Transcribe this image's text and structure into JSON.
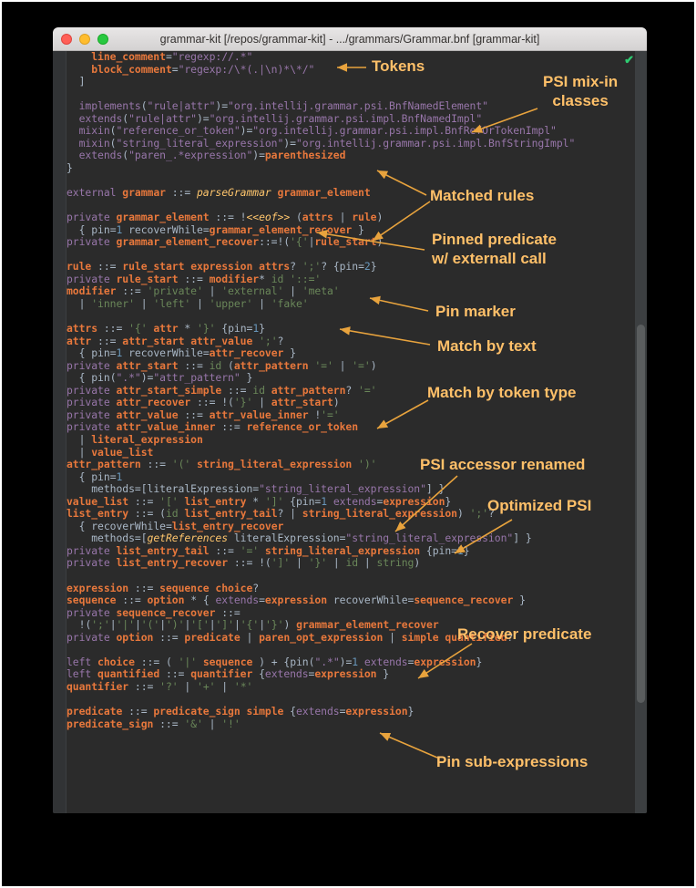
{
  "window": {
    "title": "grammar-kit [/repos/grammar-kit] - .../grammars/Grammar.bnf [grammar-kit]",
    "traffic_lights": [
      "close-button",
      "minimize-button",
      "zoom-button"
    ],
    "status_icon": "✔"
  },
  "colors": {
    "editor_background": "#2b2b2b",
    "gutter": "#313335",
    "annotation": "#ffc069",
    "rule_name": "#e8783c",
    "keyword": "#9876aa",
    "string": "#6a8759",
    "number": "#6897bb",
    "default_text": "#a9b7c6",
    "status_ok": "#2ecc71",
    "titlebar": "#e0dede",
    "page_background": "#000000"
  },
  "annotations": [
    {
      "id": "tokens",
      "label": "Tokens"
    },
    {
      "id": "psi-mixin",
      "label": "PSI mix-in\nclasses"
    },
    {
      "id": "matched-rules",
      "label": "Matched rules"
    },
    {
      "id": "pinned-predicate",
      "label": "Pinned predicate\nw/ externall call"
    },
    {
      "id": "pin-marker",
      "label": "Pin marker"
    },
    {
      "id": "match-by-text",
      "label": "Match by text"
    },
    {
      "id": "match-by-token",
      "label": "Match by token type"
    },
    {
      "id": "psi-accessor",
      "label": "PSI accessor renamed"
    },
    {
      "id": "optimized-psi",
      "label": "Optimized PSI"
    },
    {
      "id": "recover-predicate",
      "label": "Recover predicate"
    },
    {
      "id": "pin-sub",
      "label": "Pin sub-expressions"
    }
  ],
  "code": {
    "language": "BNF",
    "file": "Grammar.bnf",
    "lines": [
      "    line_comment=\"regexp://.*\"",
      "    block_comment=\"regexp:/\\*(.|\\n)*\\*/\"",
      "  ]",
      "",
      "  implements(\"rule|attr\")=\"org.intellij.grammar.psi.BnfNamedElement\"",
      "  extends(\"rule|attr\")=\"org.intellij.grammar.psi.impl.BnfNamedImpl\"",
      "  mixin(\"reference_or_token\")=\"org.intellij.grammar.psi.impl.BnfRefOrTokenImpl\"",
      "  mixin(\"string_literal_expression\")=\"org.intellij.grammar.psi.impl.BnfStringImpl\"",
      "  extends(\"paren_.*expression\")=parenthesized",
      "}",
      "",
      "external grammar ::= parseGrammar grammar_element",
      "",
      "private grammar_element ::= !<<eof>> (attrs | rule)",
      "  { pin=1 recoverWhile=grammar_element_recover }",
      "private grammar_element_recover::=!('{'|rule_start)",
      "",
      "rule ::= rule_start expression attrs? ';'? {pin=2}",
      "private rule_start ::= modifier* id '::='",
      "modifier ::= 'private' | 'external' | 'meta'",
      "  | 'inner' | 'left' | 'upper' | 'fake'",
      "",
      "attrs ::= '{' attr * '}' {pin=1}",
      "attr ::= attr_start attr_value ';'?",
      "  { pin=1 recoverWhile=attr_recover }",
      "private attr_start ::= id (attr_pattern '=' | '=')",
      "  { pin(\".*\")=\"attr_pattern\" }",
      "private attr_start_simple ::= id attr_pattern? '='",
      "private attr_recover ::= !('}' | attr_start)",
      "private attr_value ::= attr_value_inner !'='",
      "private attr_value_inner ::= reference_or_token",
      "  | literal_expression",
      "  | value_list",
      "attr_pattern ::= '(' string_literal_expression ')'",
      "  { pin=1",
      "    methods=[literalExpression=\"string_literal_expression\"] }",
      "value_list ::= '[' list_entry * ']' {pin=1 extends=expression}",
      "list_entry ::= (id list_entry_tail? | string_literal_expression) ';'?",
      "  { recoverWhile=list_entry_recover",
      "    methods=[getReferences literalExpression=\"string_literal_expression\"] }",
      "private list_entry_tail ::= '=' string_literal_expression {pin=1}",
      "private list_entry_recover ::= !(']' | '}' | id | string)",
      "",
      "expression ::= sequence choice?",
      "sequence ::= option * { extends=expression recoverWhile=sequence_recover }",
      "private sequence_recover ::=",
      "  !(';'|'|'|'('|')'|'['|']'|'{'|'}') grammar_element_recover",
      "private option ::= predicate | paren_opt_expression | simple quantified?",
      "",
      "left choice ::= ( '|' sequence ) + {pin(\".*\")=1 extends=expression}",
      "left quantified ::= quantifier {extends=expression }",
      "quantifier ::= '?' | '+' | '*'",
      "",
      "predicate ::= predicate_sign simple {extends=expression}",
      "predicate_sign ::= '&' | '!'"
    ]
  }
}
